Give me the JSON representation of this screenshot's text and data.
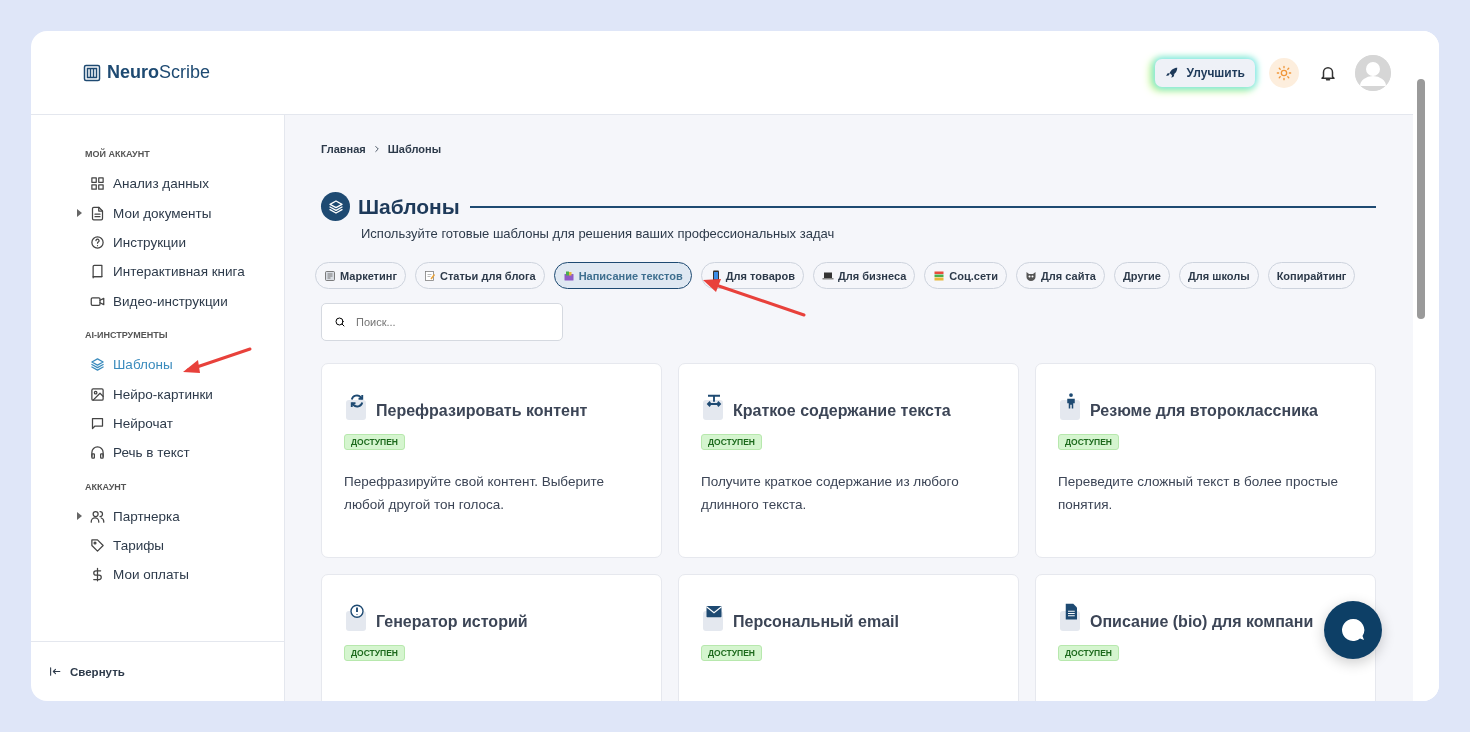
{
  "brand": {
    "name_bold": "Neuro",
    "name_rest": "Scribe"
  },
  "header": {
    "upgrade_label": "Улучшить"
  },
  "sidebar": {
    "sections": [
      {
        "title": "МОЙ АККАУНТ",
        "items": [
          {
            "label": "Анализ данных",
            "kind": "grid",
            "expandable": false,
            "selected": false
          },
          {
            "label": "Мои документы",
            "kind": "doc",
            "expandable": true,
            "selected": false
          },
          {
            "label": "Инструкции",
            "kind": "help",
            "expandable": false,
            "selected": false
          },
          {
            "label": "Интерактивная книга",
            "kind": "book",
            "expandable": false,
            "selected": false
          },
          {
            "label": "Видео-инструкции",
            "kind": "video",
            "expandable": false,
            "selected": false
          }
        ]
      },
      {
        "title": "AI-ИНСТРУМЕНТЫ",
        "items": [
          {
            "label": "Шаблоны",
            "kind": "layers",
            "expandable": false,
            "selected": true
          },
          {
            "label": "Нейро-картинки",
            "kind": "image",
            "expandable": false,
            "selected": false
          },
          {
            "label": "Нейрочат",
            "kind": "chat",
            "expandable": false,
            "selected": false
          },
          {
            "label": "Речь в текст",
            "kind": "headphones",
            "expandable": false,
            "selected": false
          }
        ]
      },
      {
        "title": "АККАУНТ",
        "items": [
          {
            "label": "Партнерка",
            "kind": "users",
            "expandable": true,
            "selected": false
          },
          {
            "label": "Тарифы",
            "kind": "tag",
            "expandable": false,
            "selected": false
          },
          {
            "label": "Мои оплаты",
            "kind": "dollar",
            "expandable": false,
            "selected": false
          }
        ]
      }
    ],
    "collapse_label": "Свернуть"
  },
  "breadcrumb": [
    "Главная",
    "Шаблоны"
  ],
  "page": {
    "title": "Шаблоны",
    "subtitle": "Используйте готовые шаблоны для решения ваших профессиональных задач"
  },
  "tabs": [
    {
      "label": "Маркетинг",
      "kind": "notebook",
      "selected": false
    },
    {
      "label": "Статьи для блога",
      "kind": "memo",
      "selected": false
    },
    {
      "label": "Написание текстов",
      "kind": "bag",
      "selected": true
    },
    {
      "label": "Для товаров",
      "kind": "phone",
      "selected": false
    },
    {
      "label": "Для бизнеса",
      "kind": "laptop",
      "selected": false
    },
    {
      "label": "Соц.сети",
      "kind": "books",
      "selected": false
    },
    {
      "label": "Для сайта",
      "kind": "cat",
      "selected": false
    },
    {
      "label": "Другие",
      "kind": "plain",
      "selected": false
    },
    {
      "label": "Для школы",
      "kind": "plain",
      "selected": false
    },
    {
      "label": "Копирайтинг",
      "kind": "plain",
      "selected": false
    }
  ],
  "search": {
    "placeholder": "Поиск..."
  },
  "cards": [
    {
      "title": "Перефразировать контент",
      "kind": "cycle",
      "badge": "ДОСТУПЕН",
      "description": "Перефразируйте свой контент. Выберите любой другой тон голоса."
    },
    {
      "title": "Краткое содержание текста",
      "kind": "swap",
      "badge": "ДОСТУПЕН",
      "description": "Получите краткое содержание из любого длинного текста."
    },
    {
      "title": "Резюме для второклассника",
      "kind": "child",
      "badge": "ДОСТУПЕН",
      "description": "Переведите сложный текст в более простые понятия."
    },
    {
      "title": "Генератор историй",
      "kind": "alert",
      "badge": "ДОСТУПЕН"
    },
    {
      "title": "Персональный email",
      "kind": "mail",
      "badge": "ДОСТУПЕН"
    },
    {
      "title": "Описание (bio) для компани",
      "kind": "file",
      "badge": "ДОСТУПЕН"
    }
  ]
}
